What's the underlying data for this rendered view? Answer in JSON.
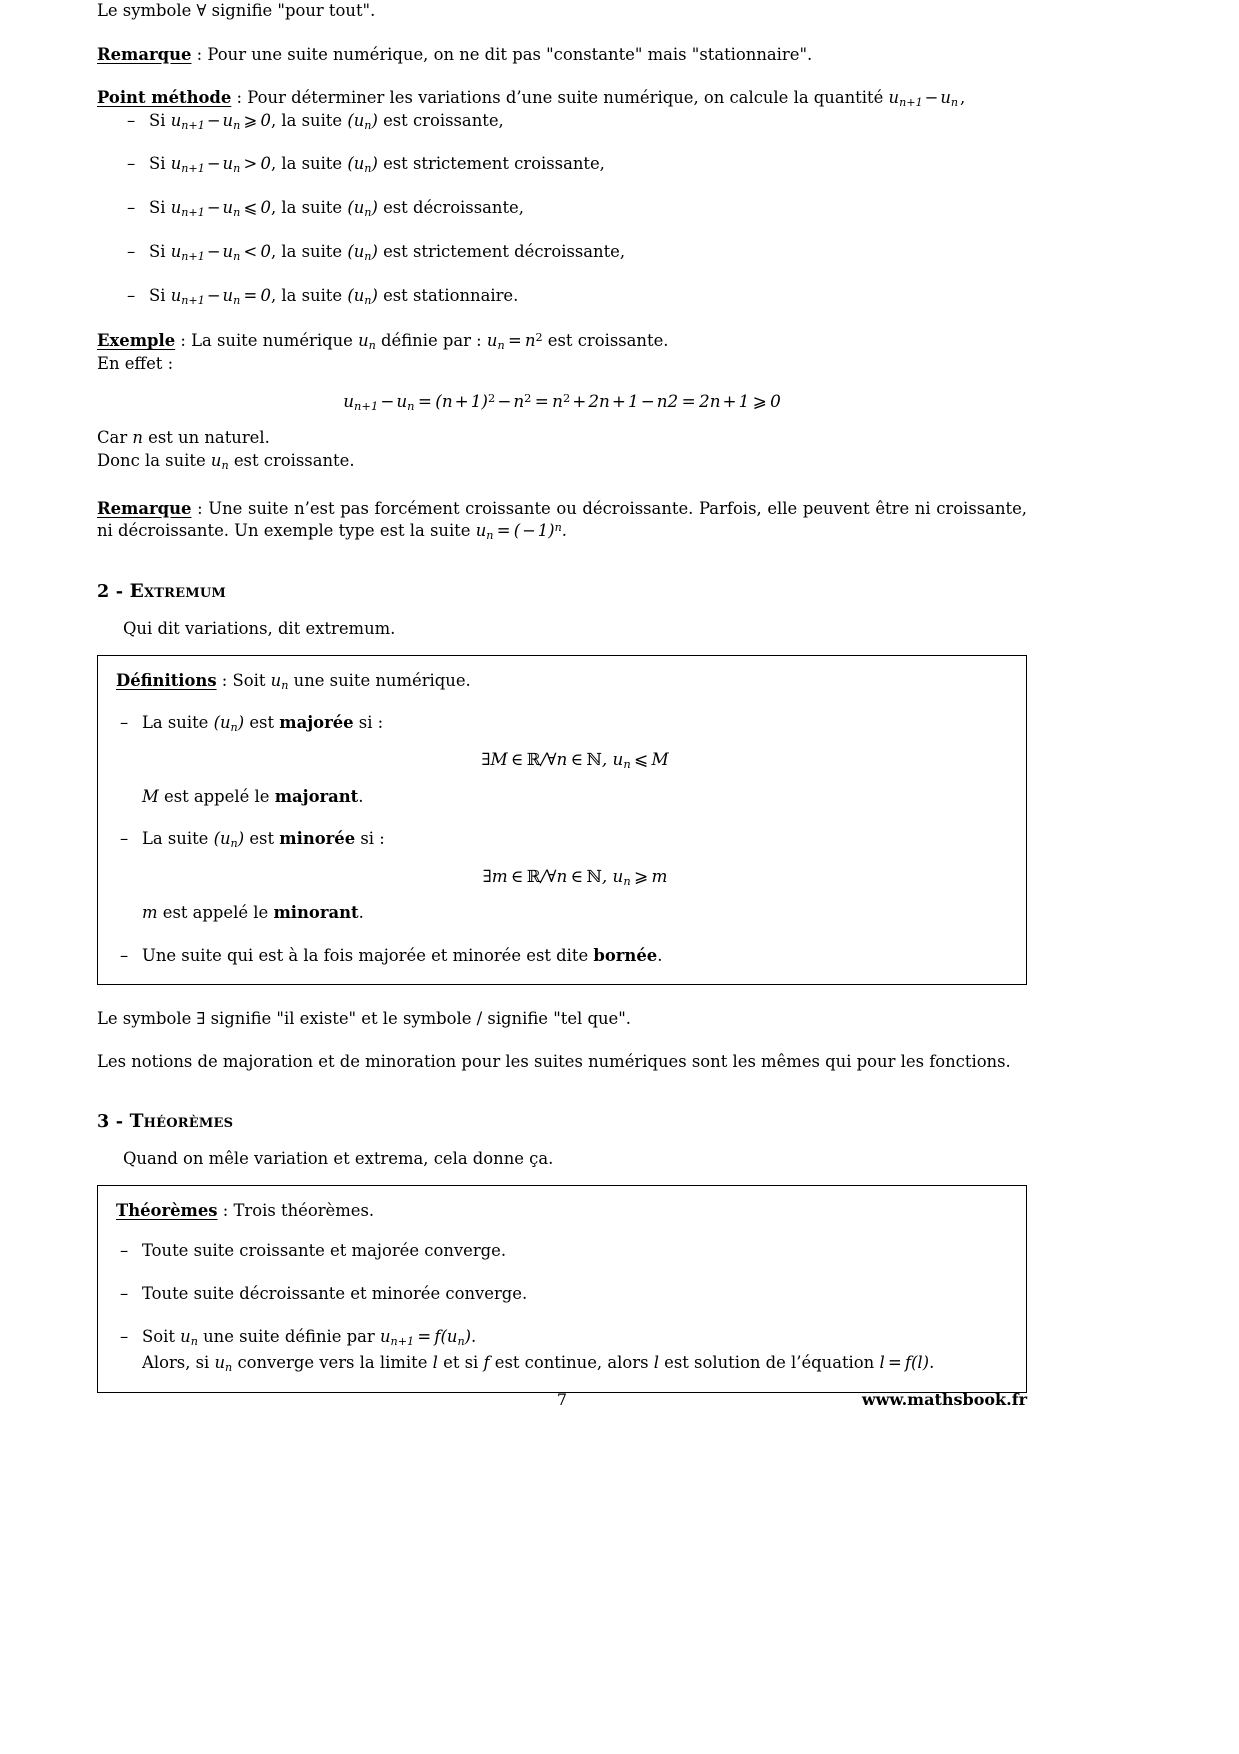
{
  "document": {
    "page_number": "7",
    "website": "www.mathsbook.fr",
    "language": "fr"
  },
  "intro": {
    "forall_note_pre": "Le symbole ",
    "forall_symbol": "∀",
    "forall_note_post": " signifie \"pour tout\"."
  },
  "remark_1": {
    "label": "Remarque",
    "separator": " : ",
    "text": "Pour une suite numérique, on ne dit pas \"constante\" mais \"stationnaire\"."
  },
  "point_methode": {
    "label": "Point méthode",
    "separator": " : ",
    "text": "Pour déterminer les variations d’une suite numérique, on calcule la quantité ",
    "quantity": "u_{n+1} − u_n,",
    "items": [
      {
        "condition": "u_{n+1} − u_n ⩾ 0",
        "relation": "⩾",
        "conclusion": "la suite (u_n) est croissante,"
      },
      {
        "condition": "u_{n+1} − u_n > 0",
        "relation": ">",
        "conclusion": "la suite (u_n) est strictement croissante,"
      },
      {
        "condition": "u_{n+1} − u_n ⩽ 0",
        "relation": "⩽",
        "conclusion": "la suite (u_n) est décroissante,"
      },
      {
        "condition": "u_{n+1} − u_n < 0",
        "relation": "<",
        "conclusion": "la suite (u_n) est strictement décroissante,"
      },
      {
        "condition": "u_{n+1} − u_n = 0",
        "relation": "=",
        "conclusion": "la suite (u_n) est stationnaire."
      }
    ],
    "item_prefix": "Si ",
    "item_mid_1": ", la suite ",
    "item_mid_2": " est ",
    "labels": {
      "croissante": "croissante,",
      "strictement_croissante": "strictement croissante,",
      "decroissante": "décroissante,",
      "strictement_decroissante": "strictement décroissante,",
      "stationnaire": "stationnaire."
    }
  },
  "exemple": {
    "label": "Exemple",
    "separator": " : ",
    "text_a": "La suite numérique ",
    "text_b": " définie par : ",
    "formula_def": "u_n = n²",
    "text_c": " est croissante.",
    "en_effet": "En effet :",
    "equation": "u_{n+1} − u_n = (n + 1)² − n² = n² + 2n + 1 − n2 = 2n + 1 ⩾ 0",
    "car_pre": "Car ",
    "car_var": "n",
    "car_post": " est un naturel.",
    "donc_pre": "Donc la suite ",
    "donc_var": "u_n",
    "donc_post": " est croissante."
  },
  "remark_2": {
    "label": "Remarque",
    "separator": " : ",
    "text": "Une suite n’est pas forcément croissante ou décroissante. Parfois, elle peuvent être ni croissante, ni décroissante. Un exemple type est la suite ",
    "formula": "u_n = (−1)^n."
  },
  "section_2": {
    "number": "2 - ",
    "title": "Extremum",
    "intro": "Qui dit variations, dit extremum."
  },
  "definitions_box": {
    "label": "Définitions",
    "separator": " : ",
    "head_text_a": "Soit ",
    "head_var": "u_n",
    "head_text_b": " une suite numérique.",
    "items": [
      {
        "text_a": "La suite ",
        "var": "(u_n)",
        "text_b": " est ",
        "bold": "majorée",
        "text_c": " si :",
        "equation": "∃M ∈ ℝ/∀n ∈ ℕ, u_n ⩽ M",
        "note_var": "M",
        "note_text": " est appelé le ",
        "note_bold": "majorant",
        "note_end": "."
      },
      {
        "text_a": "La suite ",
        "var": "(u_n)",
        "text_b": " est ",
        "bold": "minorée",
        "text_c": " si :",
        "equation": "∃m ∈ ℝ/∀n ∈ ℕ, u_n ⩾ m",
        "note_var": "m",
        "note_text": " est appelé le ",
        "note_bold": "minorant",
        "note_end": "."
      }
    ],
    "last_item": {
      "text_a": "Une suite qui est à la fois majorée et minorée est dite ",
      "bold": "bornée",
      "text_b": "."
    }
  },
  "after_definitions": {
    "exists_note_pre": "Le symbole ",
    "exists_symbol": "∃",
    "exists_note_mid": " signifie \"il existe\" et le symbole / signifie \"tel que\".",
    "majoration_note": "Les notions de majoration et de minoration pour les suites numériques sont les mêmes qui pour les fonctions."
  },
  "section_3": {
    "number": "3 - ",
    "title": "Théorèmes",
    "intro": "Quand on mêle variation et extrema, cela donne ça."
  },
  "theorems_box": {
    "label": "Théorèmes",
    "separator": " : ",
    "head_text": "Trois théorèmes.",
    "items": [
      {
        "text": "Toute suite croissante et majorée converge."
      },
      {
        "text": "Toute suite décroissante et minorée converge."
      }
    ],
    "third": {
      "line1_a": "Soit ",
      "line1_var": "u_n",
      "line1_b": " une suite définie par ",
      "line1_formula": "u_{n+1} = f(u_n)",
      "line1_end": ".",
      "line2_a": "Alors, si ",
      "line2_var": "u_n",
      "line2_b": " converge vers la limite ",
      "line2_l": "l",
      "line2_c": " et si ",
      "line2_f": "f",
      "line2_d": " est continue, alors ",
      "line2_l2": "l",
      "line2_e": " est solution de l’équation ",
      "line2_formula": "l = f(l)",
      "line2_end": "."
    }
  }
}
